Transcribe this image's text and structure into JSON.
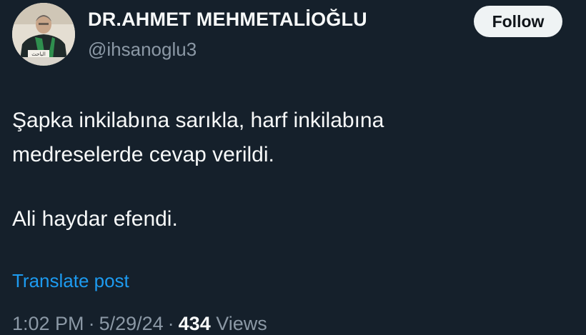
{
  "author": {
    "display_name": "DR.AHMET MEHMETALİOĞLU",
    "handle": "@ihsanoglu3",
    "avatar_plaque_text": "الباحث"
  },
  "follow_button": {
    "label": "Follow"
  },
  "post": {
    "lines": [
      "Şapka inkilabına sarıkla, harf inkilabına",
      "medreselerde cevap verildi.",
      "Ali haydar efendi."
    ]
  },
  "translate": {
    "label": "Translate post"
  },
  "meta": {
    "time": "1:02 PM",
    "separator": "·",
    "date": "5/29/24",
    "views_count": "434",
    "views_label": "Views"
  },
  "colors": {
    "background": "#15202b",
    "primary_text": "#f7f9f9",
    "secondary_text": "#8b98a5",
    "link": "#1d9bf0",
    "button_bg": "#eff3f4"
  }
}
